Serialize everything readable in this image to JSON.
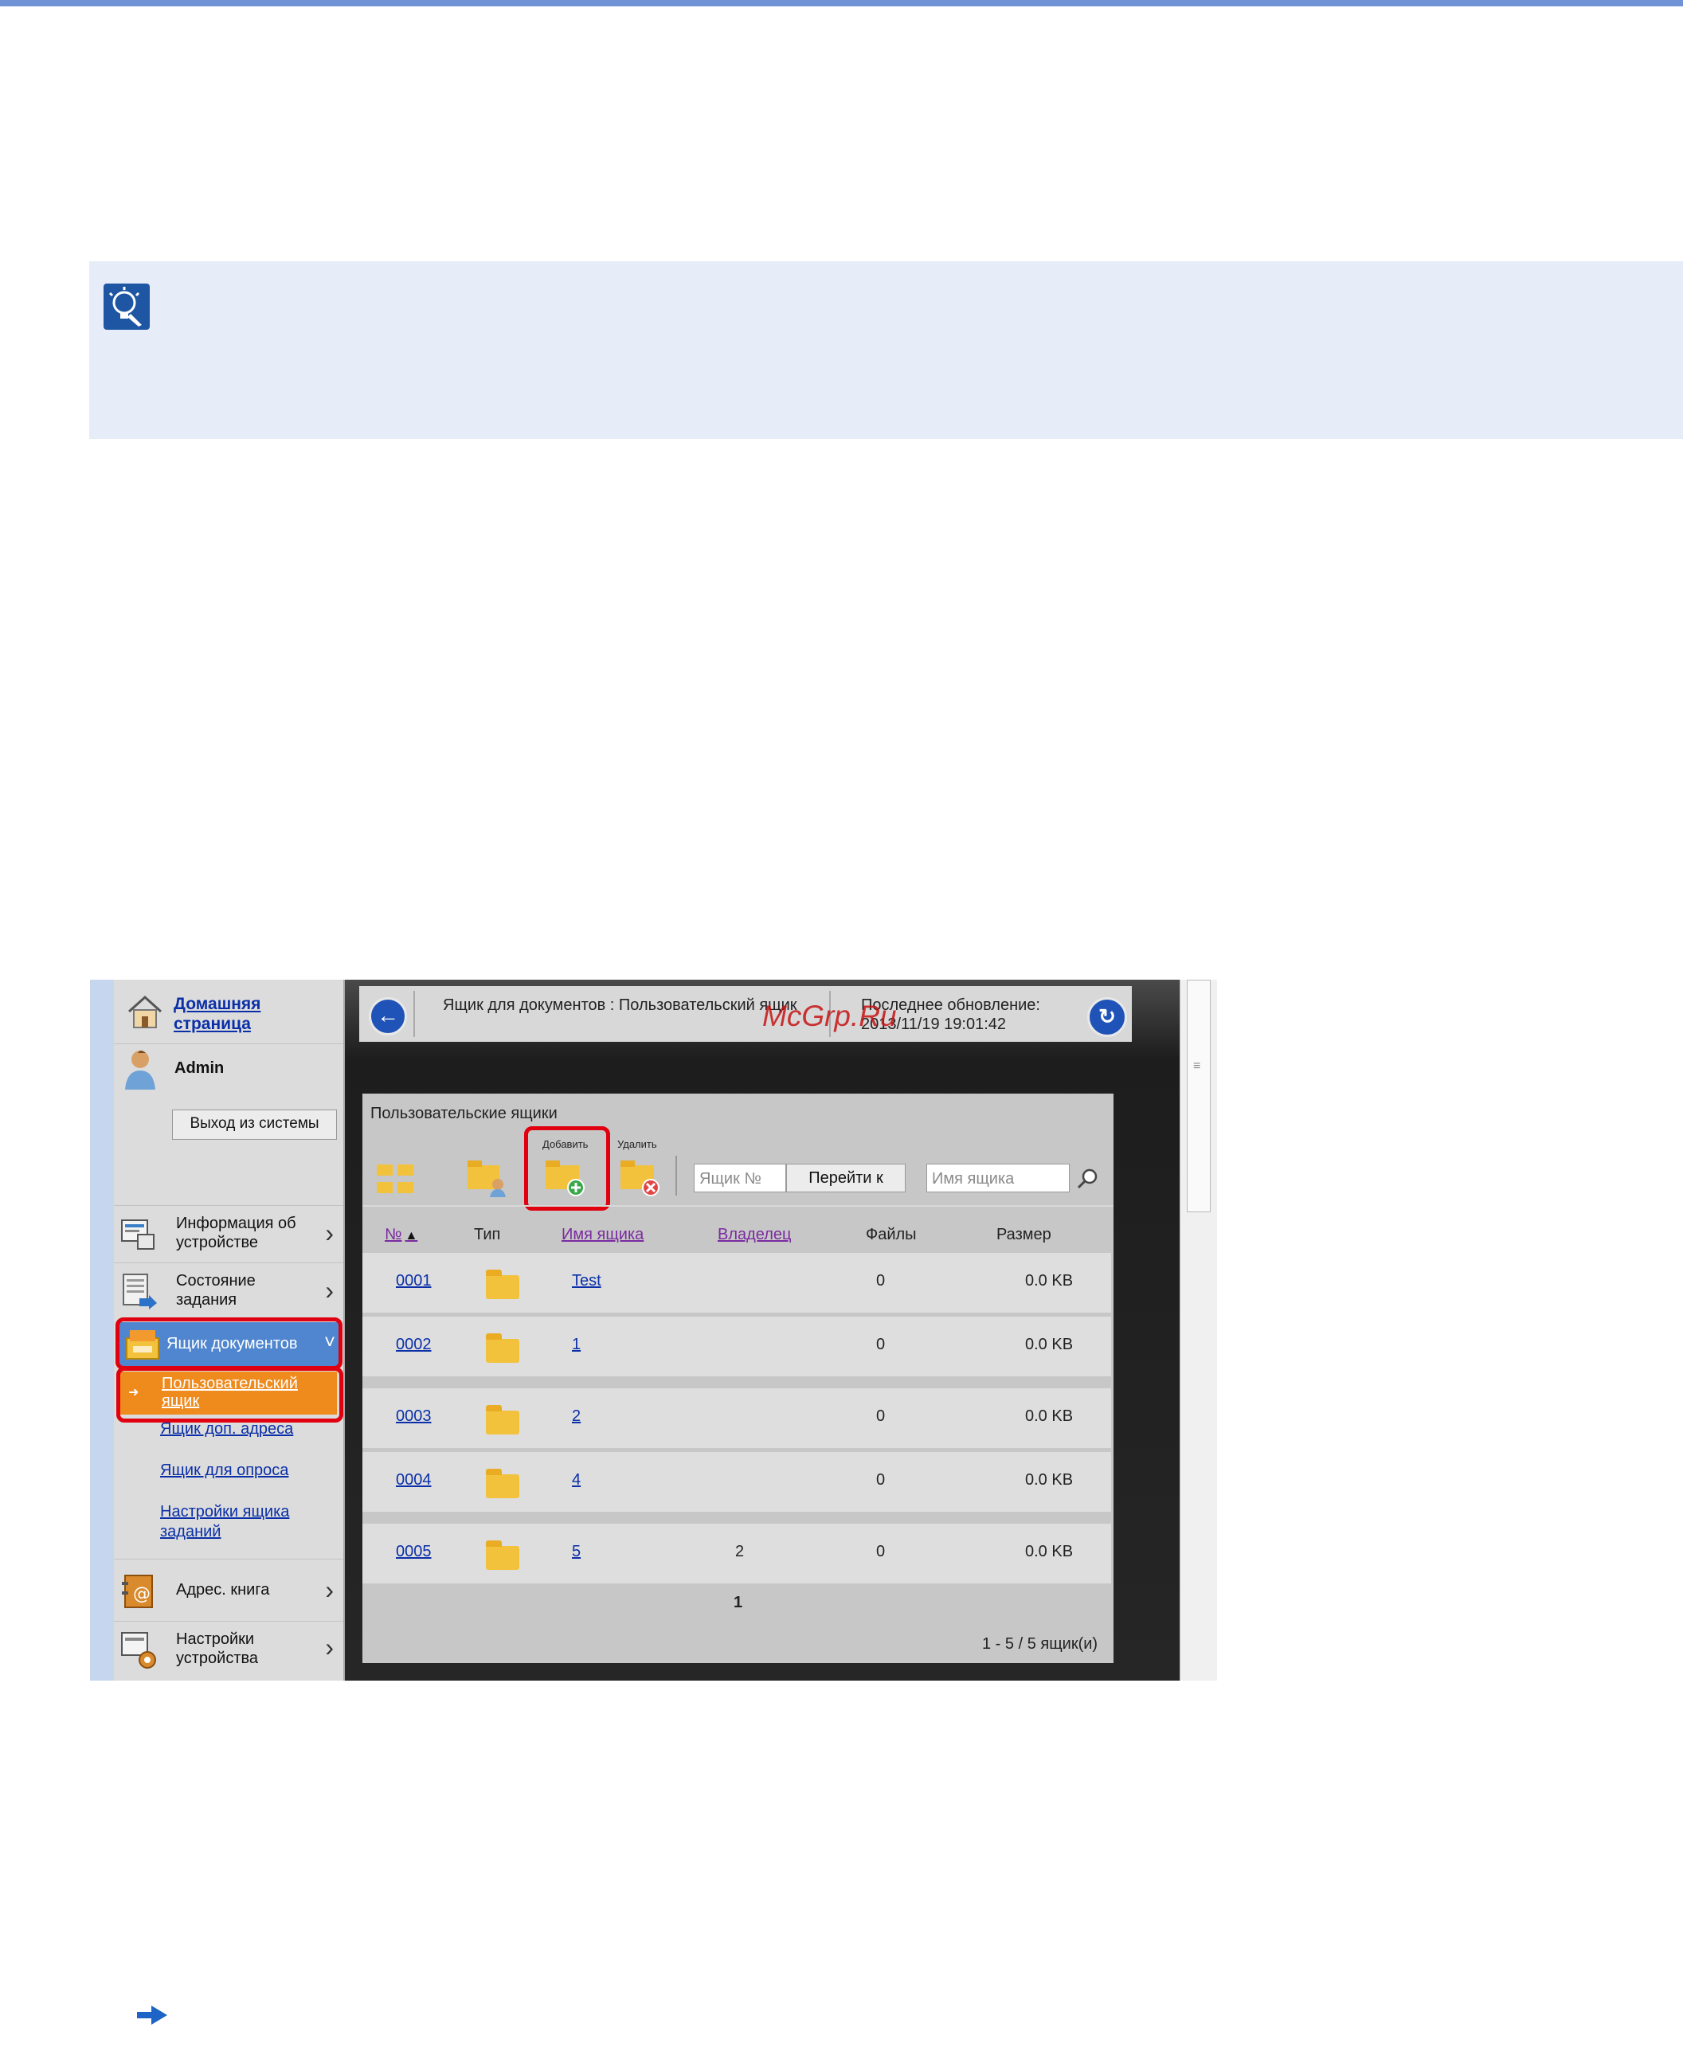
{
  "note": {
    "icon": "lightbulb-hint-icon"
  },
  "watermark": "McGrp.Ru",
  "sidebar": {
    "home_label": "Домашняя страница",
    "user_name": "Admin",
    "logout_label": "Выход из системы",
    "nav": [
      {
        "label": "Информация об устройстве",
        "icon": "device-info-icon"
      },
      {
        "label": "Состояние задания",
        "icon": "job-status-icon"
      },
      {
        "label": "Ящик документов",
        "icon": "document-box-icon"
      },
      {
        "label": "Адрес. книга",
        "icon": "address-book-icon"
      },
      {
        "label": "Настройки устройства",
        "icon": "device-settings-icon"
      }
    ],
    "subitems": [
      "Пользовательский ящик",
      "Ящик доп. адреса",
      "Ящик для опроса",
      "Настройки ящика заданий"
    ]
  },
  "header": {
    "breadcrumb": "Ящик для документов : Пользовательский ящик",
    "update_label": "Последнее обновление:",
    "update_time": "2013/11/19 19:01:42"
  },
  "panel": {
    "title": "Пользовательские ящики",
    "add_label": "Добавить",
    "delete_label": "Удалить",
    "box_no_placeholder": "Ящик №",
    "goto_label": "Перейти к",
    "box_name_placeholder": "Имя ящика",
    "columns": [
      "№",
      "Тип",
      "Имя ящика",
      "Владелец",
      "Файлы",
      "Размер"
    ],
    "rows": [
      {
        "no": "0001",
        "name": "Test",
        "owner": "",
        "files": "0",
        "size": "0.0 KB"
      },
      {
        "no": "0002",
        "name": "1",
        "owner": "",
        "files": "0",
        "size": "0.0 KB"
      },
      {
        "no": "0003",
        "name": "2",
        "owner": "",
        "files": "0",
        "size": "0.0 KB"
      },
      {
        "no": "0004",
        "name": "4",
        "owner": "",
        "files": "0",
        "size": "0.0 KB"
      },
      {
        "no": "0005",
        "name": "5",
        "owner": "2",
        "files": "0",
        "size": "0.0 KB"
      }
    ],
    "page": "1",
    "count": "1 - 5 / 5 ящик(и)"
  },
  "colors": {
    "accent": "#6f93d6",
    "highlight": "#e00010",
    "selected": "#ef8a1c"
  }
}
